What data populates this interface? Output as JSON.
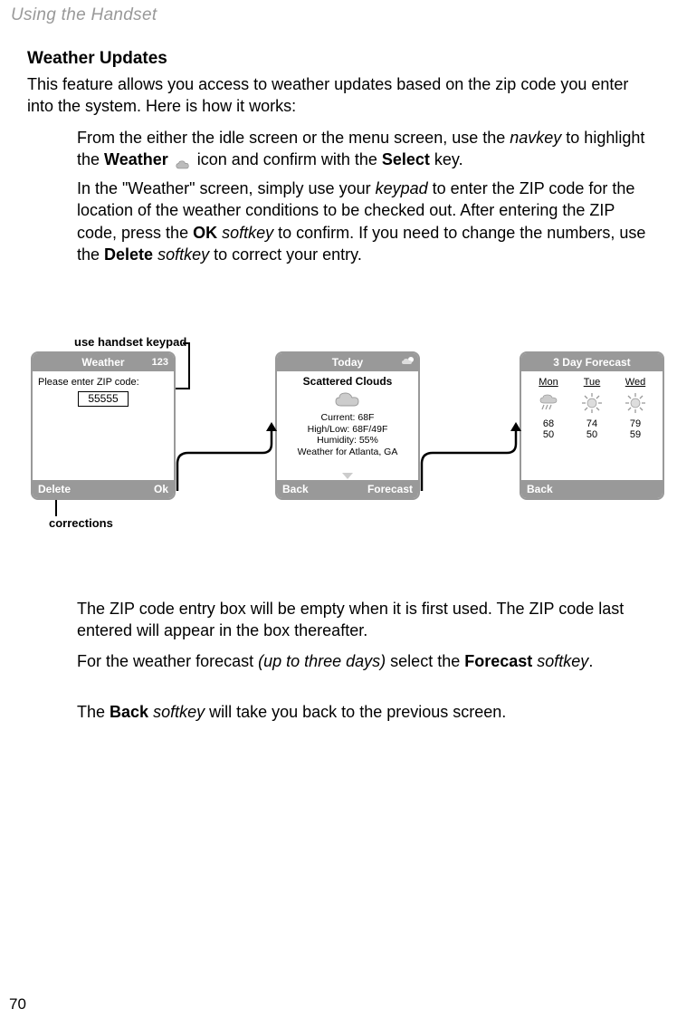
{
  "header": "Using the Handset",
  "section_title": "Weather Updates",
  "intro": "This feature allows you access to weather updates based on the zip code you enter into the system. Here is how it works:",
  "para1_a": "From the either the idle screen or the menu screen, use the ",
  "para1_navkey": "navkey",
  "para1_b": " to highlight the ",
  "para1_weather": "Weather",
  "para1_c": " icon and confirm with the ",
  "para1_select": "Select",
  "para1_d": " key.",
  "para2_a": "In the \"Weather\" screen, simply use your ",
  "para2_keypad": "keypad",
  "para2_b": " to enter the ZIP code for the location of the weather conditions to be checked out. After entering the ZIP code, press the ",
  "para2_ok": "OK",
  "para2_c": " ",
  "para2_softkey": "softkey",
  "para2_d": " to confirm. If you need to change the numbers, use the ",
  "para2_delete": "Delete",
  "para2_e": " ",
  "para2_softkey2": "softkey",
  "para2_f": " to correct your entry.",
  "annot_keypad": "use handset keypad",
  "annot_corrections": "corrections",
  "screens": {
    "weather": {
      "title": "Weather",
      "indicator": "123",
      "prompt": "Please enter ZIP code:",
      "zip": "55555",
      "left_softkey": "Delete",
      "right_softkey": "Ok"
    },
    "today": {
      "title": "Today",
      "condition": "Scattered Clouds",
      "current": "Current: 68F",
      "highlow": "High/Low: 68F/49F",
      "humidity": "Humidity: 55%",
      "location": "Weather for Atlanta, GA",
      "left_softkey": "Back",
      "right_softkey": "Forecast"
    },
    "forecast": {
      "title": "3 Day Forecast",
      "days": [
        {
          "name": "Mon",
          "high": "68",
          "low": "50",
          "icon": "rain"
        },
        {
          "name": "Tue",
          "high": "74",
          "low": "50",
          "icon": "sun"
        },
        {
          "name": "Wed",
          "high": "79",
          "low": "59",
          "icon": "sun"
        }
      ],
      "left_softkey": "Back"
    }
  },
  "para3": "The ZIP code entry box will be empty when it is first used. The ZIP code last entered will appear in the box thereafter.",
  "para4_a": "For the weather forecast ",
  "para4_uptothree": "(up to three days)",
  "para4_b": " select the ",
  "para4_forecast": "Forecast",
  "para4_c": " ",
  "para4_softkey": "softkey",
  "para4_d": ".",
  "para5_a": "The ",
  "para5_back": "Back",
  "para5_b": " ",
  "para5_softkey": "softkey",
  "para5_c": " will take you back to the previous screen.",
  "page_num": "70"
}
